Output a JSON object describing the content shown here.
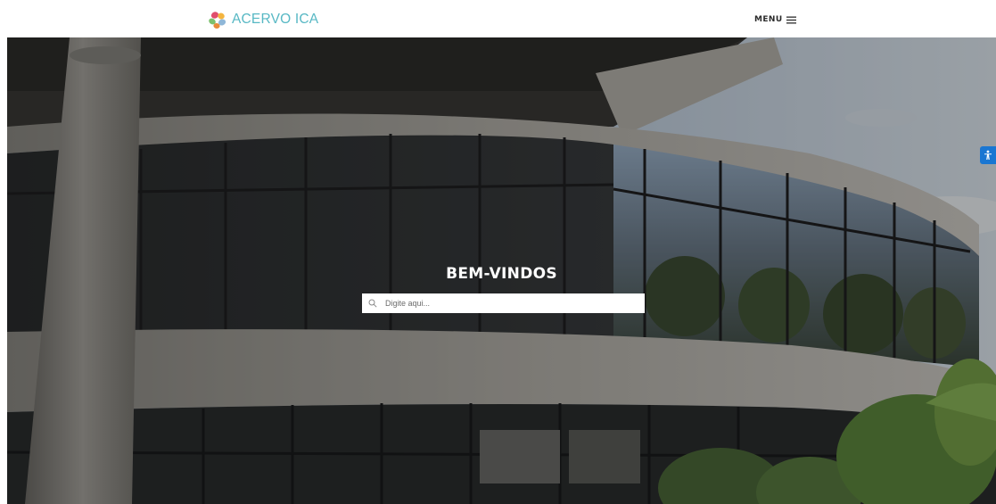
{
  "header": {
    "logo_text": "ACERVO ICA",
    "menu_label": "MENU"
  },
  "hero": {
    "title": "BEM-VINDOS"
  },
  "search": {
    "placeholder": "Digite aqui..."
  },
  "icons": {
    "logo": "acervo-ica-logo-icon",
    "menu": "hamburger-icon",
    "search": "search-icon",
    "accessibility": "accessibility-icon"
  },
  "colors": {
    "brand": "#57b8c4",
    "accessibility_button": "#1a76d2"
  }
}
